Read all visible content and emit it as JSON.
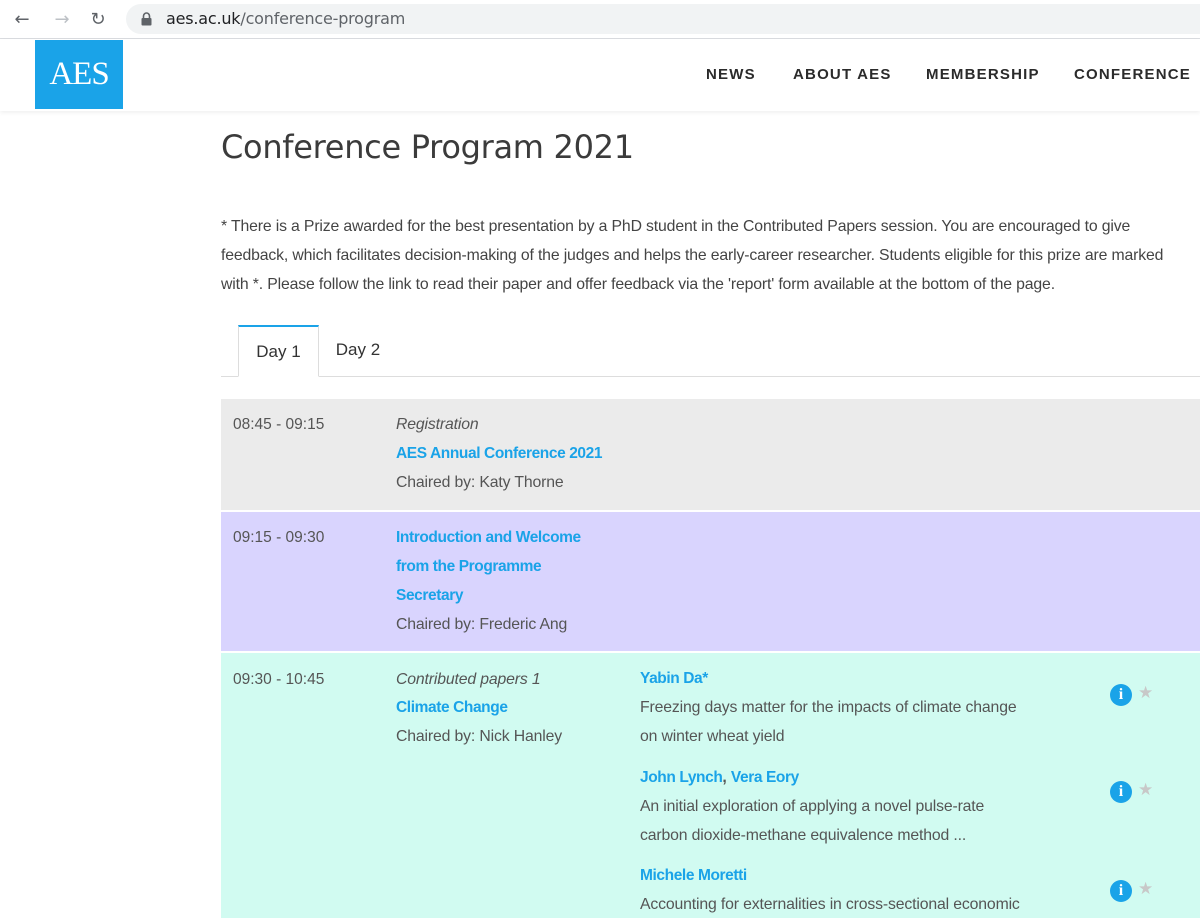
{
  "browser": {
    "url_domain": "aes.ac.uk",
    "url_path": "/conference-program"
  },
  "site": {
    "logo": "AES",
    "nav": [
      "NEWS",
      "ABOUT AES",
      "MEMBERSHIP",
      "CONFERENCE"
    ]
  },
  "page": {
    "title": "Conference Program 2021",
    "intro_lines": [
      "* There is a Prize awarded for the best presentation by a PhD student in the Contributed Papers session. You are encouraged to give",
      "feedback, which facilitates decision-making of the judges and helps the early-career researcher. Students eligible for this prize are marked",
      "with *. Please follow the link to read their paper and offer feedback via the 'report' form available at the bottom of the page."
    ]
  },
  "tabs": [
    "Day 1",
    "Day 2"
  ],
  "sessions": [
    {
      "time": "08:45 - 09:15",
      "category": "Registration",
      "title": "AES Annual Conference 2021",
      "chair": "Chaired by: Katy Thorne"
    },
    {
      "time": "09:15 - 09:30",
      "title_lines": [
        "Introduction and Welcome",
        "from the Programme",
        "Secretary"
      ],
      "chair": "Chaired by: Frederic Ang"
    },
    {
      "time": "09:30 - 10:45",
      "category": "Contributed papers 1",
      "title": "Climate Change",
      "chair": "Chaired by: Nick Hanley",
      "papers": [
        {
          "authors": [
            "Yabin Da*"
          ],
          "title_lines": [
            "Freezing days matter for the impacts of climate change",
            "on winter wheat yield"
          ]
        },
        {
          "authors": [
            "John Lynch",
            "Vera Eory"
          ],
          "separator": ", ",
          "title_lines": [
            "An initial exploration of applying a novel pulse-rate",
            "carbon dioxide-methane equivalence method ..."
          ]
        },
        {
          "authors": [
            "Michele Moretti"
          ],
          "title_lines": [
            "Accounting for externalities in cross-sectional economic"
          ]
        }
      ]
    }
  ],
  "icons": {
    "info": "i",
    "star": "★"
  },
  "colors": {
    "brand": "#1aa3e8",
    "registration_bg": "#ebebeb",
    "welcome_bg": "#d9d4fe",
    "contributed_bg": "#d1fbf1"
  }
}
